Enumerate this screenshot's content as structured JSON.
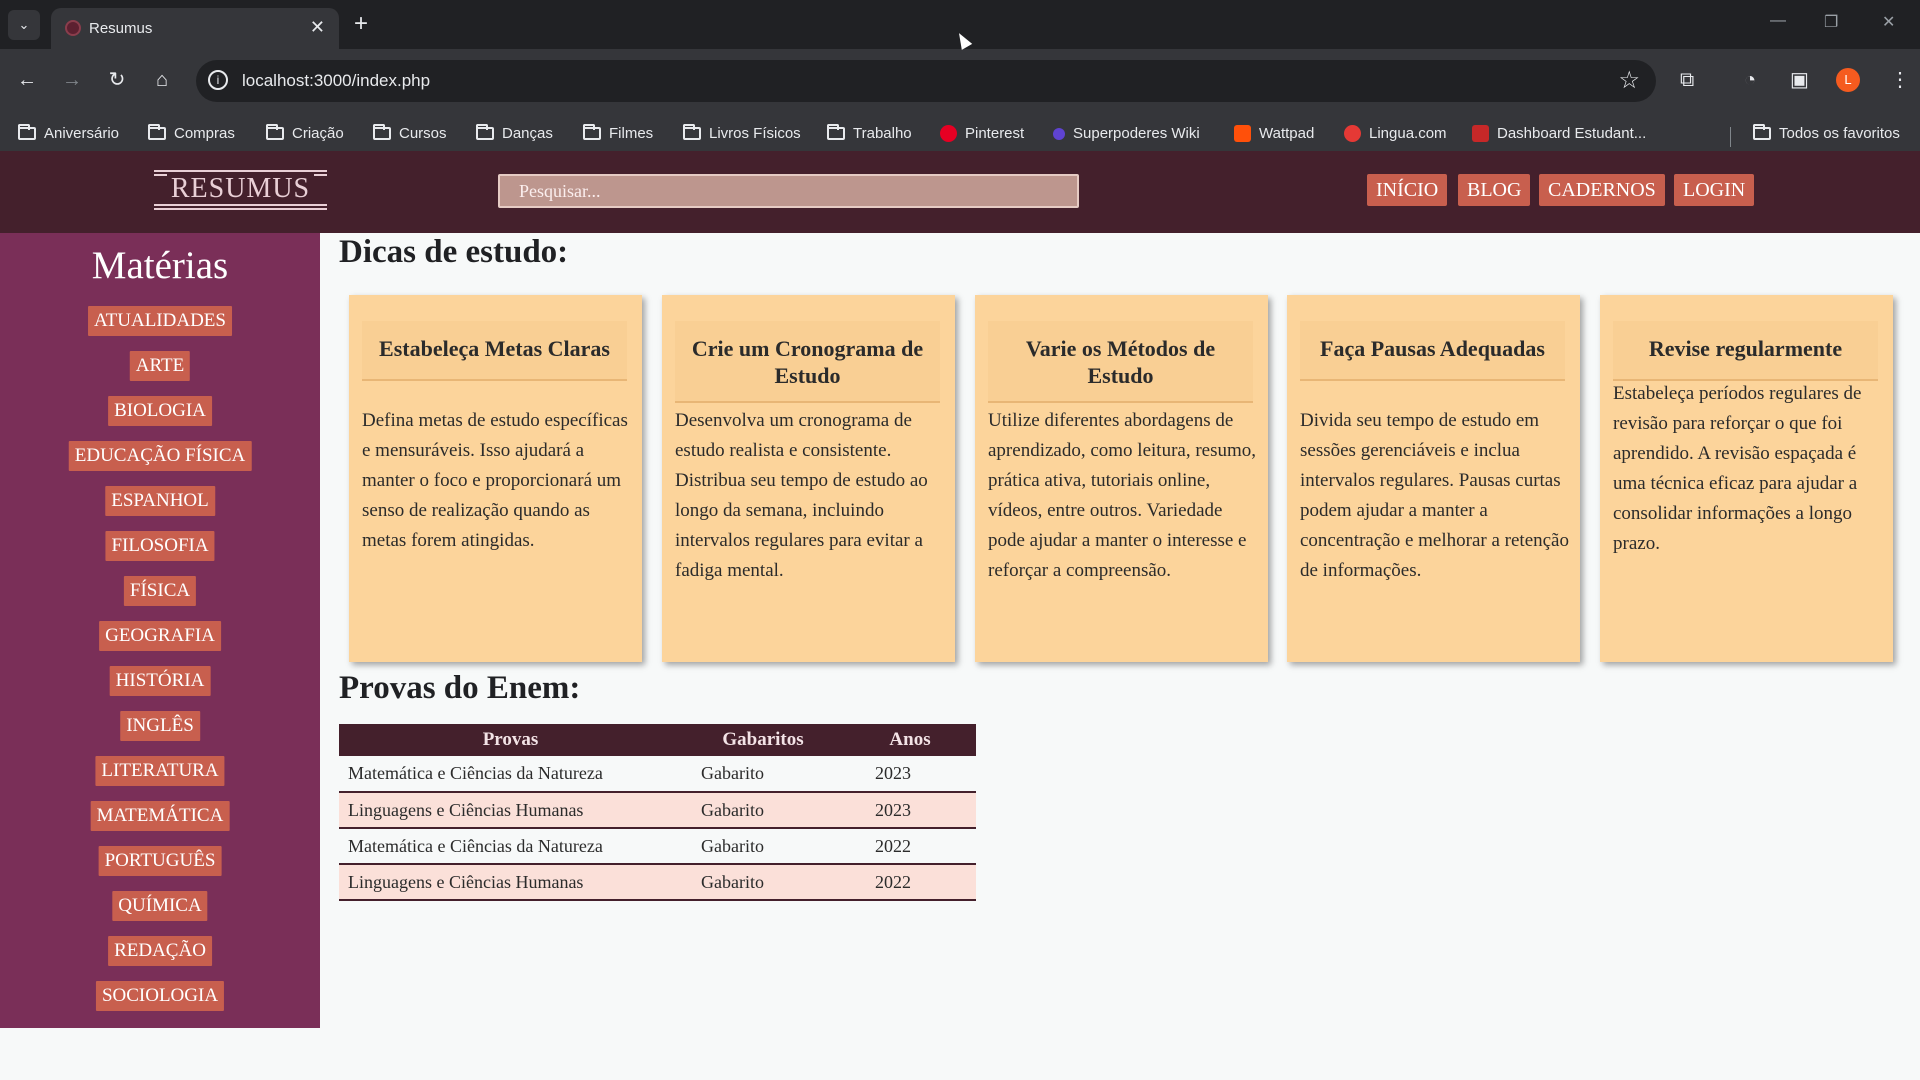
{
  "browser": {
    "tab_title": "Resumus",
    "url": "localhost:3000/index.php",
    "profile_initial": "L",
    "bookmarks": [
      {
        "label": "Aniversário",
        "icon": "folder-icon"
      },
      {
        "label": "Compras",
        "icon": "folder-icon"
      },
      {
        "label": "Criação",
        "icon": "folder-icon"
      },
      {
        "label": "Cursos",
        "icon": "folder-icon"
      },
      {
        "label": "Danças",
        "icon": "folder-icon"
      },
      {
        "label": "Filmes",
        "icon": "folder-icon"
      },
      {
        "label": "Livros Físicos",
        "icon": "folder-icon"
      },
      {
        "label": "Trabalho",
        "icon": "folder-icon"
      },
      {
        "label": "Pinterest",
        "icon": "pinterest-icon",
        "color": "#e60023"
      },
      {
        "label": "Superpoderes Wiki",
        "icon": "fandom-icon",
        "color": "#5f43d1"
      },
      {
        "label": "Wattpad",
        "icon": "wattpad-icon",
        "color": "#ff500a"
      },
      {
        "label": "Lingua.com",
        "icon": "lingua-icon",
        "color": "#e53935"
      },
      {
        "label": "Dashboard Estudant...",
        "icon": "dashboard-icon",
        "color": "#c62828"
      }
    ],
    "all_bookmarks_label": "Todos os favoritos"
  },
  "site": {
    "logo_text": "RESUMUS",
    "search_placeholder": "Pesquisar...",
    "nav": [
      "INÍCIO",
      "BLOG",
      "CADERNOS",
      "LOGIN"
    ]
  },
  "sidebar": {
    "title": "Matérias",
    "items": [
      "ATUALIDADES",
      "ARTE",
      "BIOLOGIA",
      "EDUCAÇÃO FÍSICA",
      "ESPANHOL",
      "FILOSOFIA",
      "FÍSICA",
      "GEOGRAFIA",
      "HISTÓRIA",
      "INGLÊS",
      "LITERATURA",
      "MATEMÁTICA",
      "PORTUGUÊS",
      "QUÍMICA",
      "REDAÇÃO",
      "SOCIOLOGIA"
    ]
  },
  "tips": {
    "title": "Dicas de estudo:",
    "cards": [
      {
        "heading": "Estabeleça Metas Claras",
        "text": "Defina metas de estudo específicas e mensuráveis. Isso ajudará a manter o foco e proporcionará um senso de realização quando as metas forem atingidas."
      },
      {
        "heading": "Crie um Cronograma de Estudo",
        "text": "Desenvolva um cronograma de estudo realista e consistente. Distribua seu tempo de estudo ao longo da semana, incluindo intervalos regulares para evitar a fadiga mental."
      },
      {
        "heading": "Varie os Métodos de Estudo",
        "text": "Utilize diferentes abordagens de aprendizado, como leitura, resumo, prática ativa, tutoriais online, vídeos, entre outros. Variedade pode ajudar a manter o interesse e reforçar a compreensão."
      },
      {
        "heading": "Faça Pausas Adequadas",
        "text": "Divida seu tempo de estudo em sessões gerenciáveis e inclua intervalos regulares. Pausas curtas podem ajudar a manter a concentração e melhorar a retenção de informações."
      },
      {
        "heading": "Revise regularmente",
        "text": "Estabeleça períodos regulares de revisão para reforçar o que foi aprendido. A revisão espaçada é uma técnica eficaz para ajudar a consolidar informações a longo prazo."
      }
    ]
  },
  "exams": {
    "title": "Provas do Enem:",
    "headers": [
      "Provas",
      "Gabaritos",
      "Anos"
    ],
    "rows": [
      [
        "Matemática e Ciências da Natureza",
        "Gabarito",
        "2023"
      ],
      [
        "Linguagens e Ciências Humanas",
        "Gabarito",
        "2023"
      ],
      [
        "Matemática e Ciências da Natureza",
        "Gabarito",
        "2022"
      ],
      [
        "Linguagens e Ciências Humanas",
        "Gabarito",
        "2022"
      ]
    ]
  },
  "colors": {
    "header": "#44202c",
    "sidebar": "#7a2f58",
    "button": "#c85f4e",
    "card": "#fcd49b"
  }
}
